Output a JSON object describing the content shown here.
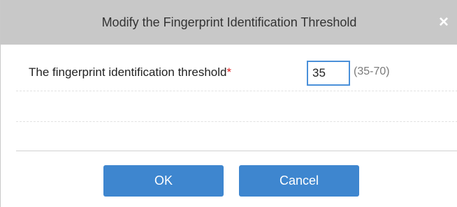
{
  "dialog": {
    "title": "Modify the Fingerprint Identification Threshold",
    "close_symbol": "×",
    "close_icon": "close-icon"
  },
  "form": {
    "label": "The fingerprint identification threshold",
    "required_marker": "*",
    "value": "35",
    "range_hint": "(35-70)"
  },
  "buttons": {
    "ok_label": "OK",
    "cancel_label": "Cancel"
  },
  "colors": {
    "titlebar": "#c8c8c8",
    "button": "#3e86cf",
    "input_border": "#4a90d9",
    "required": "#e02020"
  }
}
